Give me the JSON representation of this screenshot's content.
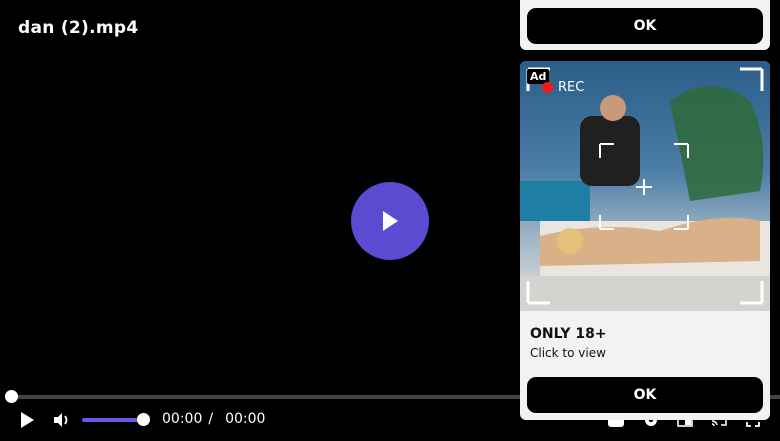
{
  "video": {
    "title": "dan (2).mp4",
    "current_time": "00:00",
    "separator": "/",
    "duration": "00:00",
    "progress": 0,
    "volume": 1.0
  },
  "ad": {
    "badge": "Ad",
    "rec_label": "REC",
    "headline": "ONLY 18+",
    "subtext": "Click to view",
    "ok_top": "OK",
    "ok_bottom": "OK"
  },
  "icons": {
    "big_play": "play-icon",
    "play": "play-icon",
    "volume": "volume-icon",
    "captions": "captions-icon",
    "settings": "gear-icon",
    "pip": "pip-icon",
    "cast": "cast-icon",
    "fullscreen": "fullscreen-icon"
  },
  "colors": {
    "accent": "#5a4bd1",
    "volume_fill": "#6758e6",
    "rec_dot": "#f21a1a"
  }
}
